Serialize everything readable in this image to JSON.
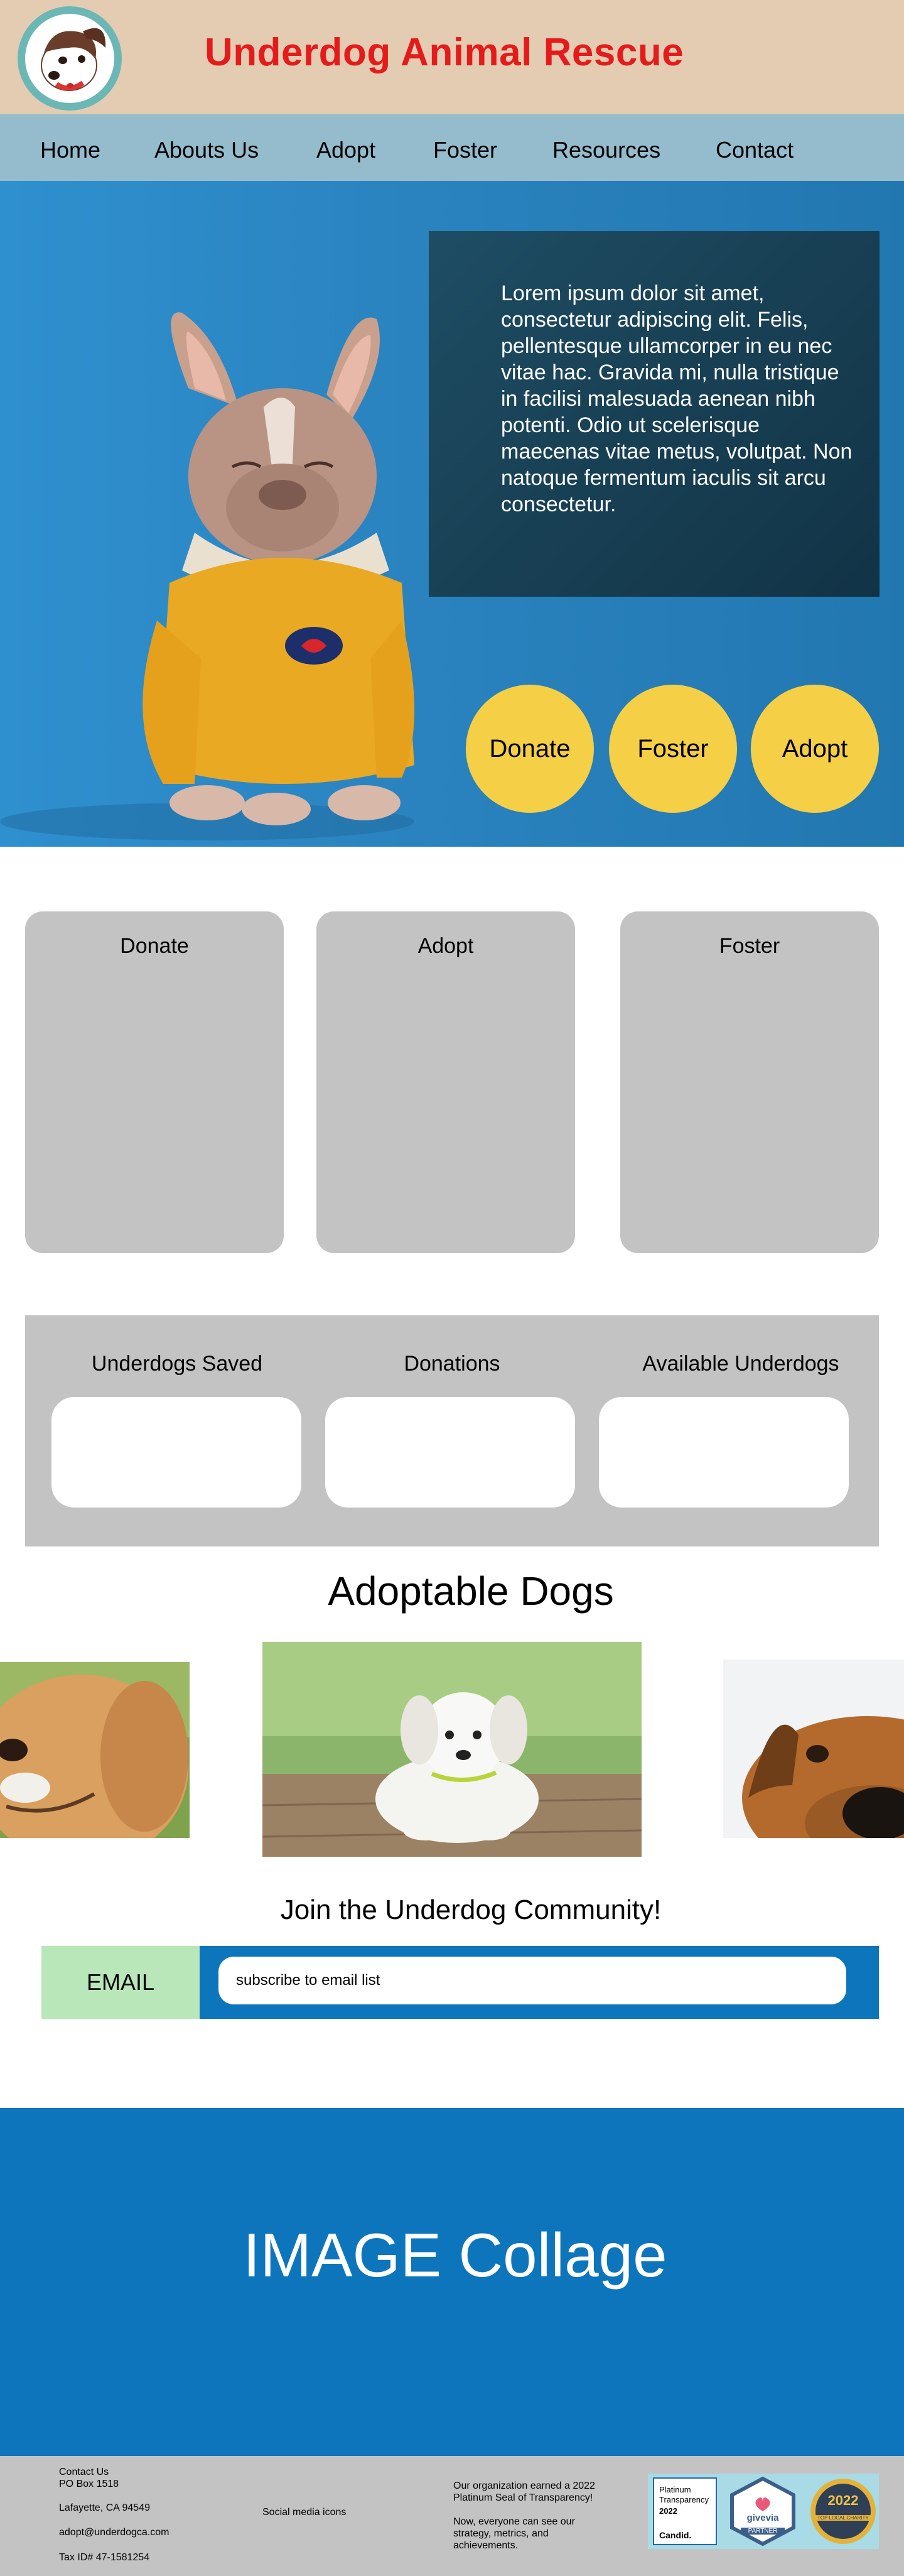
{
  "header": {
    "brand": "Underdog Animal Rescue",
    "logo_icon": "dog-face-icon",
    "brand_color": "#e51b1b",
    "background": "#e3ccb2"
  },
  "nav": {
    "items": [
      {
        "label": "Home"
      },
      {
        "label": "Abouts Us"
      },
      {
        "label": "Adopt"
      },
      {
        "label": "Foster"
      },
      {
        "label": "Resources"
      },
      {
        "label": "Contact"
      }
    ],
    "background": "#95bccd"
  },
  "hero": {
    "image": "french-bulldog-yellow-sweater",
    "text": "Lorem ipsum dolor sit amet, consectetur adipiscing elit. Felis, pellentesque ullamcorper in eu nec vitae hac. Gravida mi, nulla tristique in facilisi malesuada aenean nibh potenti. Odio ut scelerisque maecenas vitae metus, volutpat. Non natoque fermentum iaculis sit arcu consectetur.",
    "buttons": [
      {
        "label": "Donate"
      },
      {
        "label": "Foster"
      },
      {
        "label": "Adopt"
      }
    ],
    "button_color": "#f5cf45"
  },
  "cards": [
    {
      "title": "Donate"
    },
    {
      "title": "Adopt"
    },
    {
      "title": "Foster"
    }
  ],
  "stats": [
    {
      "label": "Underdogs Saved"
    },
    {
      "label": "Donations"
    },
    {
      "label": "Available Underdogs"
    }
  ],
  "adoptable": {
    "title": "Adoptable Dogs",
    "photos": [
      "golden-retriever-photo",
      "white-puppy-photo",
      "beagle-photo"
    ]
  },
  "community": {
    "title": "Join the Underdog Community!",
    "email_label": "EMAIL",
    "email_placeholder": "subscribe to email list"
  },
  "collage": {
    "text": "IMAGE Collage",
    "background": "#0d75bb"
  },
  "footer": {
    "contact_title": "Contact Us",
    "po_box": "PO Box 1518",
    "city": "Lafayette, CA 94549",
    "email": "adopt@underdogca.com",
    "tax_id": "Tax ID# 47-1581254",
    "social": "Social media icons",
    "award_line1": "Our organization earned a 2022",
    "award_line2": "Platinum Seal of Transparency!",
    "award_line3": "Now, everyone can see our",
    "award_line4": "strategy, metrics, and",
    "award_line5": "achievements.",
    "badge1_line1": "Platinum",
    "badge1_line2": "Transparency",
    "badge1_line3": "2022",
    "badge1_line4": "Candid.",
    "badge2_line1": "givevia",
    "badge2_line2": "PARTNER",
    "badge3_line1": "2022",
    "badge3_line2": "TOP LOCAL CHARITY"
  }
}
